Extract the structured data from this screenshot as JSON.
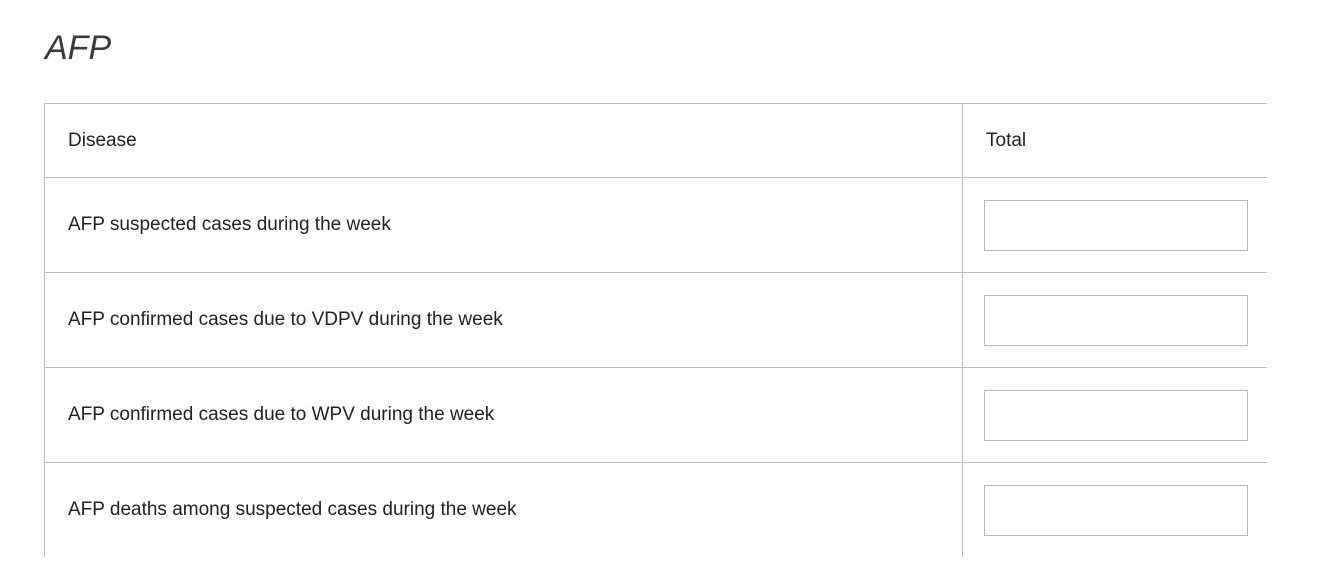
{
  "section": {
    "title": "AFP"
  },
  "table": {
    "columns": [
      "Disease",
      "Total"
    ],
    "rows": [
      {
        "label": "AFP suspected cases during the week",
        "value": ""
      },
      {
        "label": "AFP confirmed cases due to VDPV during the week",
        "value": ""
      },
      {
        "label": "AFP confirmed cases due to WPV during the week",
        "value": ""
      },
      {
        "label": "AFP deaths among suspected cases during the week",
        "value": ""
      }
    ]
  }
}
